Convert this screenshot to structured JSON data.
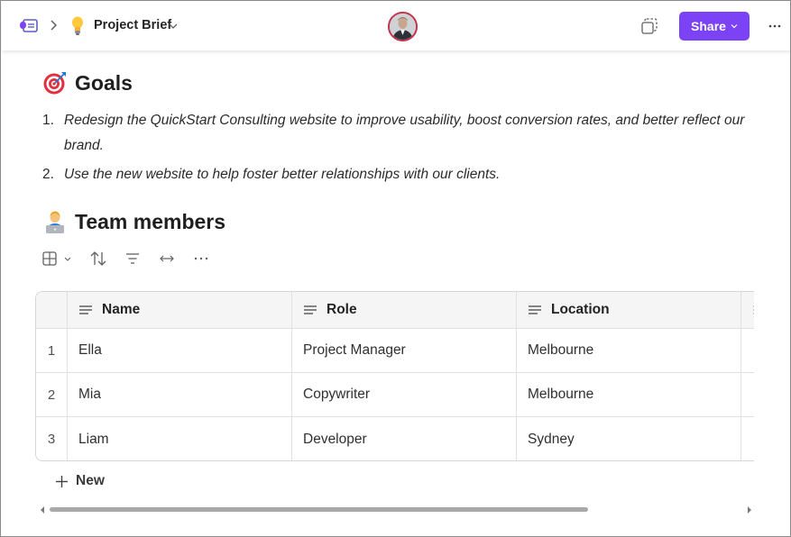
{
  "topbar": {
    "app_icon": "loop-app-icon",
    "breadcrumb_chevron": "chevron-right-icon",
    "doc_emoji": "lightbulb",
    "doc_title": "Project Brief",
    "share_label": "Share",
    "more_icon": "more-horizontal-icon",
    "accent_color": "#7b42f6"
  },
  "goals": {
    "emoji": "direct-hit",
    "heading": "Goals",
    "items": [
      {
        "num": "1.",
        "text": "Redesign the QuickStart Consulting website to improve usability, boost conversion rates, and better reflect our brand."
      },
      {
        "num": "2.",
        "text": "Use the new website to help foster better relationships with our clients."
      }
    ]
  },
  "team": {
    "emoji": "technologist",
    "heading": "Team members",
    "toolbar_icons": [
      "table-view-icon",
      "sort-icon",
      "filter-icon",
      "column-width-icon",
      "more-horizontal-icon"
    ],
    "columns": [
      "Name",
      "Role",
      "Location"
    ],
    "rows": [
      {
        "num": "1",
        "name": "Ella",
        "role": "Project Manager",
        "location": "Melbourne"
      },
      {
        "num": "2",
        "name": "Mia",
        "role": "Copywriter",
        "location": "Melbourne"
      },
      {
        "num": "3",
        "name": "Liam",
        "role": "Developer",
        "location": "Sydney"
      }
    ],
    "new_label": "New"
  }
}
